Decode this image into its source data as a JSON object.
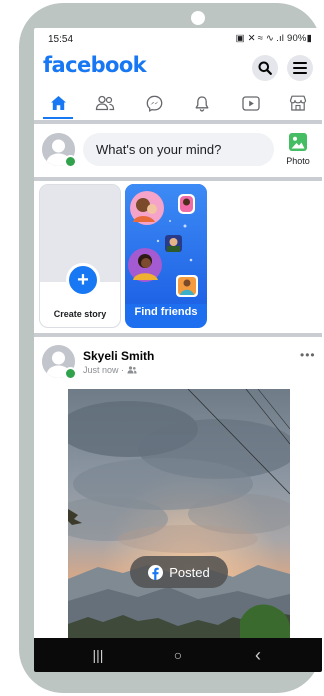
{
  "status_bar": {
    "time": "15:54",
    "indicators": "▣ ✕ ≈ ∿ .ıl 90%▮",
    "battery": "90%"
  },
  "header": {
    "logo": "facebook",
    "search_icon": "search-icon",
    "menu_icon": "menu-icon"
  },
  "nav": {
    "tabs": [
      {
        "icon": "home-icon",
        "active": true
      },
      {
        "icon": "friends-icon",
        "active": false
      },
      {
        "icon": "messenger-icon",
        "active": false
      },
      {
        "icon": "bell-icon",
        "active": false
      },
      {
        "icon": "video-icon",
        "active": false
      },
      {
        "icon": "marketplace-icon",
        "active": false
      }
    ],
    "accent": "#1877f2"
  },
  "composer": {
    "placeholder": "What's on your mind?",
    "photo_label": "Photo"
  },
  "stories": {
    "create_label": "Create story",
    "friends_label": "Find friends"
  },
  "post": {
    "author": "Skyeli Smith",
    "time": "Just now",
    "audience_icon": "friends-audience-icon",
    "more": "•••"
  },
  "toast": {
    "text": "Posted"
  },
  "system_nav": {
    "recents": "|||",
    "home": "○",
    "back": "‹"
  }
}
